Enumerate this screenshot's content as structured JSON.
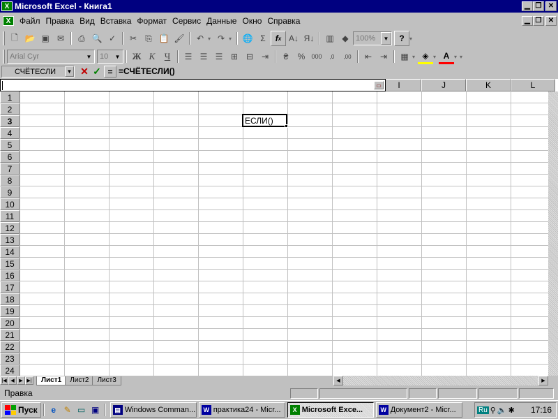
{
  "window": {
    "title": "Microsoft Excel - Книга1",
    "app_icon": "excel-icon"
  },
  "menu": {
    "items": [
      "Файл",
      "Правка",
      "Вид",
      "Вставка",
      "Формат",
      "Сервис",
      "Данные",
      "Окно",
      "Справка"
    ]
  },
  "toolbar_standard": {
    "zoom": "100%"
  },
  "toolbar_format": {
    "font_name": "Arial Cyr",
    "font_size": "10",
    "bold": "Ж",
    "italic": "К",
    "underline": "Ч",
    "font_color_letter": "A"
  },
  "formula_bar": {
    "name_box": "СЧЁТЕСЛИ",
    "cancel": "✕",
    "enter": "✓",
    "equals": "=",
    "formula": "=СЧЁТЕСЛИ()"
  },
  "grid": {
    "visible_column_headers": [
      "I",
      "J",
      "K",
      "L"
    ],
    "row_numbers": [
      "1",
      "2",
      "3",
      "4",
      "5",
      "6",
      "7",
      "8",
      "9",
      "10",
      "11",
      "12",
      "13",
      "14",
      "15",
      "16",
      "17",
      "18",
      "19",
      "20",
      "21",
      "22",
      "23",
      "24"
    ],
    "active_row": "3",
    "active_cell_text": "ЕСЛИ()"
  },
  "sheets": {
    "tabs": [
      "Лист1",
      "Лист2",
      "Лист3"
    ],
    "active": "Лист1"
  },
  "status": {
    "text": "Правка"
  },
  "taskbar": {
    "start_label": "Пуск",
    "tasks": [
      {
        "label": "Windows Comman...",
        "icon": "windows-commander-icon",
        "active": false
      },
      {
        "label": "практика24 - Micr...",
        "icon": "word-icon",
        "active": false
      },
      {
        "label": "Microsoft Exce...",
        "icon": "excel-icon",
        "active": true
      },
      {
        "label": "Документ2 - Micr...",
        "icon": "word-icon",
        "active": false
      }
    ],
    "tray_lang": "Ru",
    "clock": "17:16"
  },
  "colors": {
    "titlebar": "#000080",
    "excel_green": "#008000",
    "cancel_red": "#c00000",
    "enter_green": "#008000"
  }
}
